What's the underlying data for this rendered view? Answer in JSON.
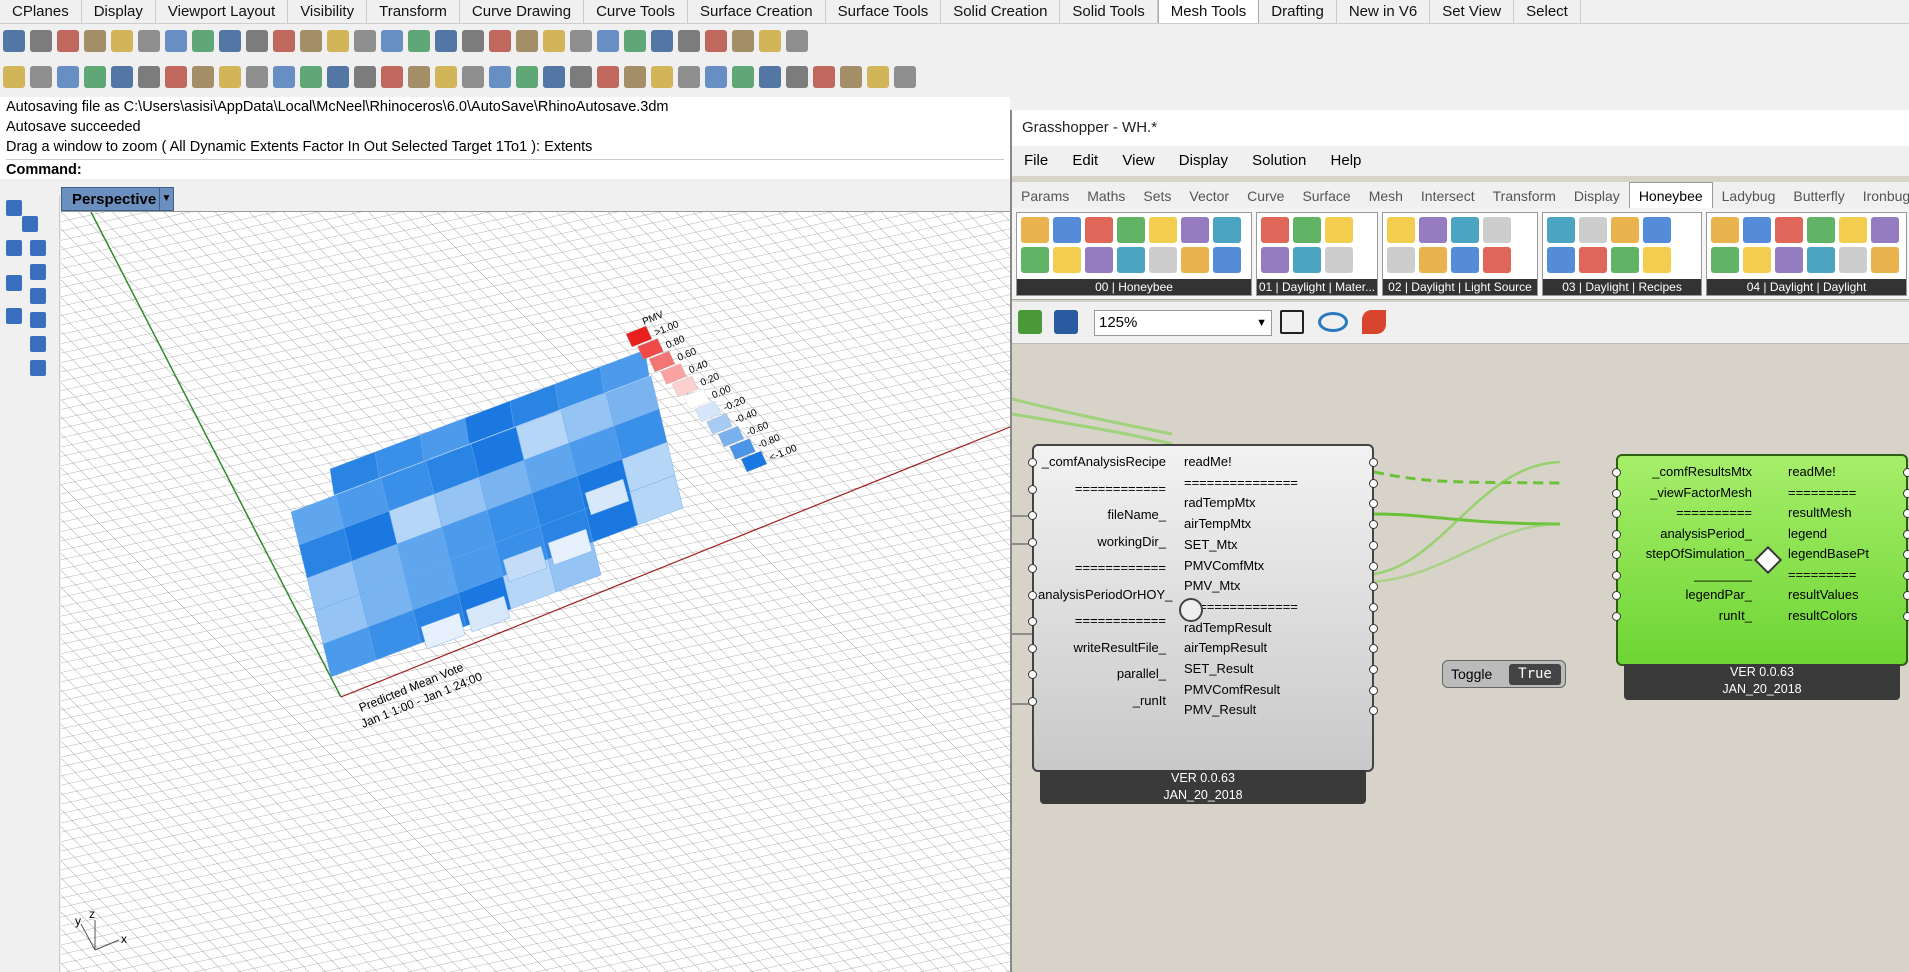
{
  "rhino": {
    "tabs": [
      "CPlanes",
      "Display",
      "Viewport Layout",
      "Visibility",
      "Transform",
      "Curve Drawing",
      "Curve Tools",
      "Surface Creation",
      "Surface Tools",
      "Solid Creation",
      "Solid Tools",
      "Mesh Tools",
      "Drafting",
      "New in V6",
      "Set View",
      "Select"
    ],
    "active_tab": "Mesh Tools",
    "command_history": [
      "Autosaving file as C:\\Users\\asisi\\AppData\\Local\\McNeel\\Rhinoceros\\6.0\\AutoSave\\RhinoAutosave.3dm",
      "Autosave succeeded",
      "Drag a window to zoom ( All  Dynamic  Extents  Factor  In  Out  Selected  Target  1To1 ): Extents"
    ],
    "command_label": "Command:",
    "viewport_name": "Perspective",
    "viewport_text": {
      "title_line1": "Predicted Mean Vote",
      "title_line2": "Jan 1 1:00 - Jan 1 24:00",
      "axis_y": "y",
      "axis_z": "z",
      "axis_x": "x"
    },
    "legend": {
      "title": "PMV",
      "labels": [
        ">1.00",
        "0.80",
        "0.60",
        "0.40",
        "0.20",
        "0.00",
        "-0.20",
        "-0.40",
        "-0.60",
        "-0.80",
        "<-1.00"
      ],
      "colors": [
        "#e8201e",
        "#ee4a48",
        "#f37574",
        "#f8a3a2",
        "#fbd0cf",
        "#ffffff",
        "#d5e6fa",
        "#a8cbf4",
        "#7ab0ee",
        "#4b94e8",
        "#1a78e0"
      ]
    }
  },
  "grasshopper": {
    "title": "Grasshopper - WH.*",
    "menu": [
      "File",
      "Edit",
      "View",
      "Display",
      "Solution",
      "Help"
    ],
    "tabs": [
      "Params",
      "Maths",
      "Sets",
      "Vector",
      "Curve",
      "Surface",
      "Mesh",
      "Intersect",
      "Transform",
      "Display",
      "Honeybee",
      "Ladybug",
      "Butterfly",
      "Ironbug"
    ],
    "active_tab": "Honeybee",
    "panels": [
      "00 | Honeybee",
      "01 | Daylight | Mater...",
      "02 | Daylight | Light Source",
      "03 | Daylight | Recipes",
      "04 | Daylight | Daylight"
    ],
    "zoom": "125%",
    "comp1": {
      "inputs": [
        "_comfAnalysisRecipe",
        "============",
        "fileName_",
        "workingDir_",
        "============",
        "analysisPeriodOrHOY_",
        "============",
        "writeResultFile_",
        "parallel_",
        "_runIt"
      ],
      "outputs": [
        "readMe!",
        "===============",
        "radTempMtx",
        "airTempMtx",
        "SET_Mtx",
        "PMVComfMtx",
        "PMV_Mtx",
        "===============",
        "radTempResult",
        "airTempResult",
        "SET_Result",
        "PMVComfResult",
        "PMV_Result"
      ],
      "version": "VER 0.0.63",
      "date": "JAN_20_2018"
    },
    "comp2": {
      "inputs": [
        "_comfResultsMtx",
        "_viewFactorMesh",
        "==========",
        "analysisPeriod_",
        "stepOfSimulation_",
        "________",
        "legendPar_",
        "runIt_"
      ],
      "outputs": [
        "readMe!",
        "=========",
        "resultMesh",
        "legend",
        "legendBasePt",
        "=========",
        "resultValues",
        "resultColors"
      ],
      "version": "VER 0.0.63",
      "date": "JAN_20_2018"
    },
    "toggle": {
      "label": "Toggle",
      "value": "True"
    }
  }
}
